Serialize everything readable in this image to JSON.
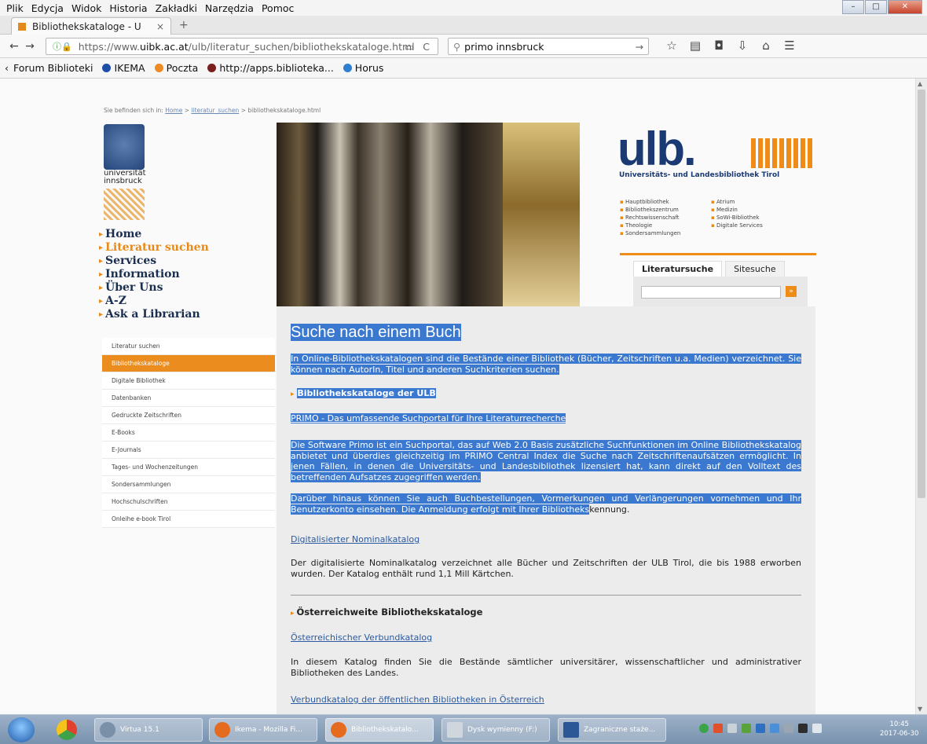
{
  "menu": [
    "Plik",
    "Edycja",
    "Widok",
    "Historia",
    "Zakładki",
    "Narzędzia",
    "Pomoc"
  ],
  "tab": {
    "title": "Bibliothekskataloge - U",
    "close": "×",
    "new": "+"
  },
  "nav": {
    "url_prefix": "https://www.",
    "url_domain": "uibk.ac.at",
    "url_path": "/ulb/literatur_suchen/bibliothekskataloge.html",
    "search_value": "primo innsbruck"
  },
  "bookmarks": [
    {
      "label": "Forum Biblioteki",
      "color": "#2a6cd4"
    },
    {
      "label": "IKEMA",
      "color": "#1d4ea8"
    },
    {
      "label": "Poczta",
      "color": "#f08a24"
    },
    {
      "label": "http://apps.biblioteka...",
      "color": "#7a1e1e"
    },
    {
      "label": "Horus",
      "color": "#2f7fd0"
    }
  ],
  "page": {
    "breadcrumb_prefix": "Sie befinden sich in:",
    "breadcrumb_home": "Home",
    "breadcrumb_sep": ">",
    "breadcrumb_lit": "literatur_suchen",
    "breadcrumb_page": "bibliothekskataloge.html",
    "uni_name_1": "universität",
    "uni_name_2": "innsbruck",
    "main_nav": [
      "Home",
      "Literatur suchen",
      "Services",
      "Information",
      "Über Uns",
      "A-Z",
      "Ask a Librarian"
    ],
    "sub_nav": [
      "Literatur suchen",
      "Bibliothekskataloge",
      "Digitale Bibliothek",
      "Datenbanken",
      "Gedruckte Zeitschriften",
      "E-Books",
      "E-Journals",
      "Tages- und Wochenzeitungen",
      "Sondersammlungen",
      "Hochschulschriften",
      "Onleihe e-book Tirol"
    ],
    "ulb_logo": "ulb.",
    "ulb_sub": "Universitäts- und Landesbibliothek Tirol",
    "libraries_col1": [
      "Hauptbibliothek",
      "Bibliothekszentrum",
      "Rechtswissenschaft",
      "Theologie",
      "Sondersammlungen"
    ],
    "libraries_col2": [
      "Atrium",
      "Medizin",
      "SoWi-Bibliothek",
      "Digitale Services",
      ""
    ],
    "search_tabs": [
      "Literatursuche",
      "Sitesuche"
    ],
    "search_go": "»"
  },
  "content": {
    "title": "Suche nach einem Buch",
    "intro": "In Online-Bibliothekskatalogen sind die Bestände einer Bibliothek (Bücher, Zeitschriften u.a. Medien) verzeichnet. Sie können nach AutorIn, Titel und anderen Suchkriterien suchen.",
    "section1": "Bibliothekskataloge der ULB",
    "primo_link": "PRIMO - Das umfassende Suchportal für Ihre Literaturrecherche",
    "primo_text": "Die Software Primo ist ein Suchportal, das auf Web 2.0 Basis zusätzliche Suchfunktionen im Online Bibliothekskatalog anbietet und überdies gleichzeitig im PRIMO Central Index die Suche nach Zeitschriftenaufsätzen ermöglicht. In jenen Fällen, in denen die Universitäts- und Landesbibliothek lizensiert hat, kann direkt auf den Volltext des betreffenden Aufsatzes zugegriffen werden.",
    "primo_text2_hl": "Darüber hinaus können Sie auch Buchbestellungen, Vormerkungen und Verlängerungen vornehmen und Ihr Benutzerkonto einsehen. Die Anmeldung erfolgt mit Ihrer Bibliotheks",
    "primo_text2_rest": "kennung.",
    "nominal_link": "Digitalisierter Nominalkatalog",
    "nominal_text": "Der digitalisierte Nominalkatalog verzeichnet alle Bücher und Zeitschriften der ULB Tirol, die bis 1988 erworben wurden. Der Katalog enthält rund 1,1 Mill Kärtchen.",
    "section2": "Österreichweite Bibliothekskataloge",
    "verbund_link": "Österreichischer Verbundkatalog",
    "verbund_text": "In diesem Katalog finden Sie die Bestände sämtlicher universitärer, wissenschaftlicher und administrativer Bibliotheken des Landes.",
    "public_link": "Verbundkatalog der öffentlichen Bibliotheken in Österreich"
  },
  "taskbar": {
    "items": [
      {
        "label": "Virtua 15.1",
        "color": "#7a8fa8"
      },
      {
        "label": "Ikema - Mozilla Fi...",
        "color": "#e56b1f"
      },
      {
        "label": "Bibliothekskatalo...",
        "color": "#e56b1f"
      },
      {
        "label": "Dysk wymienny (F:)",
        "color": "#cfd6dd"
      },
      {
        "label": "Zagraniczne staże...",
        "color": "#2b5797"
      }
    ],
    "time": "10:45",
    "date": "2017-06-30"
  }
}
